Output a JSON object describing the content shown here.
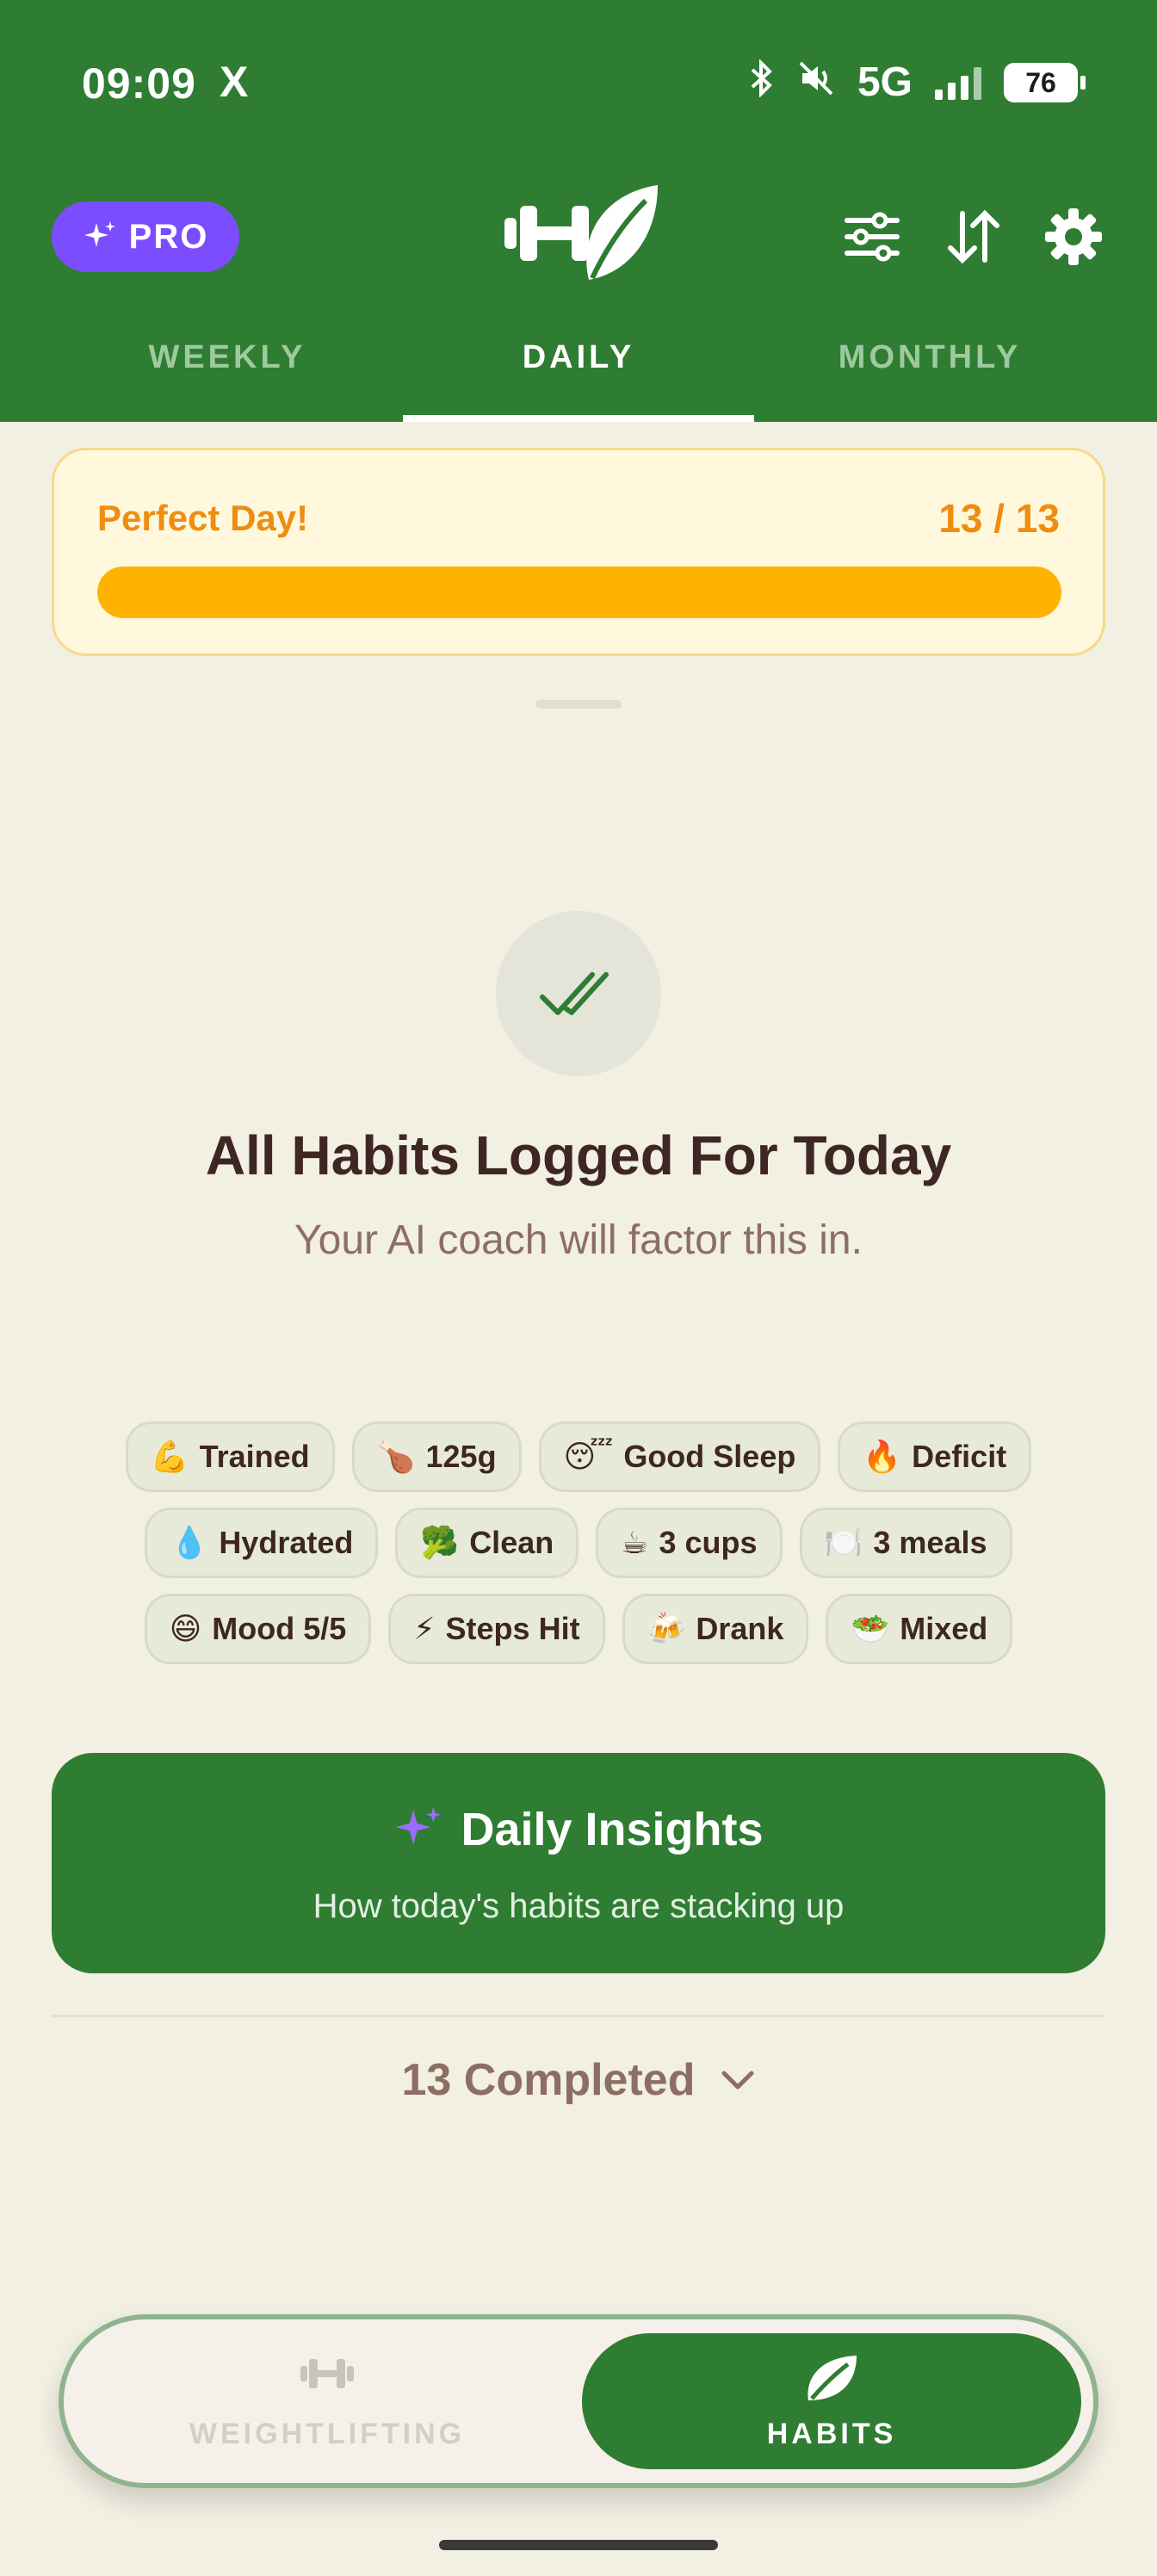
{
  "status_bar": {
    "time": "09:09",
    "x_icon": "X",
    "network": "5G",
    "battery": "76"
  },
  "header": {
    "pro_label": "PRO",
    "logo_icon": "dumbbell-leaf-logo",
    "icons": [
      "sliders-icon",
      "sort-icon",
      "gear-icon"
    ],
    "tabs": [
      {
        "label": "WEEKLY",
        "active": false
      },
      {
        "label": "DAILY",
        "active": true
      },
      {
        "label": "MONTHLY",
        "active": false
      }
    ],
    "colors": {
      "primary": "#2e7d32",
      "pro": "#7c4dff"
    }
  },
  "perfect_day": {
    "title": "Perfect Day!",
    "count": "13 / 13",
    "progress": 1.0,
    "accent": "#ffb300"
  },
  "summary": {
    "title": "All Habits Logged For Today",
    "subtitle": "Your AI coach will factor this in."
  },
  "chips": [
    [
      {
        "emoji": "💪",
        "label": "Trained"
      },
      {
        "emoji": "🍗",
        "label": "125g"
      },
      {
        "emoji": "😴",
        "label": "Good Sleep"
      },
      {
        "emoji": "🔥",
        "label": "Deficit"
      }
    ],
    [
      {
        "emoji": "💧",
        "label": "Hydrated"
      },
      {
        "emoji": "🥦",
        "label": "Clean"
      },
      {
        "emoji": "☕",
        "label": "3 cups"
      },
      {
        "emoji": "🍽️",
        "label": "3 meals"
      }
    ],
    [
      {
        "emoji": "😄",
        "label": "Mood 5/5"
      },
      {
        "emoji": "⚡",
        "label": "Steps Hit"
      },
      {
        "emoji": "🍻",
        "label": "Drank"
      },
      {
        "emoji": "🥗",
        "label": "Mixed"
      }
    ]
  ],
  "insights": {
    "title": "Daily Insights",
    "subtitle": "How today's habits are stacking up"
  },
  "completed": {
    "label": "13 Completed"
  },
  "bottom_nav": {
    "items": [
      {
        "label": "WEIGHTLIFTING",
        "icon": "dumbbell-icon",
        "active": false
      },
      {
        "label": "HABITS",
        "icon": "leaf-icon",
        "active": true
      }
    ]
  }
}
